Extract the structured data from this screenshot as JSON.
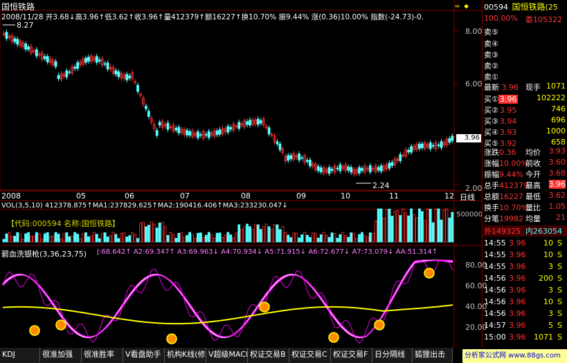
{
  "header": {
    "stock_name": "国恒铁路",
    "quote_line": "2008/11/28 开3.68↓高3.96↑低3.62↑收3.96↑量412379↑额16227↑换10.70% 振9.44% 涨(0.36)10.00% 指数(-24.73)-0.",
    "high_label": "8.27",
    "low_label": "2.24",
    "price_tag": "3.96",
    "scroll_icons": "⇔ ◆"
  },
  "price_axis": [
    "8.00",
    "6.00",
    "4.00",
    "2.00"
  ],
  "date_axis": [
    "2008",
    "05",
    "06",
    "07",
    "08",
    "09",
    "10",
    "11",
    "12"
  ],
  "period_label": "日线",
  "vol": {
    "line": "VOL(3,5,10) 412378.875↑MA1:237829.625↑MA2:190416.406↑MA3:233230.047↓",
    "code_box": "【代码:000594 名称:国恒铁路】",
    "axis": "500000"
  },
  "indicator": {
    "line_name": "碧血洗银枪(3,36,23,75)",
    "line_values": "J:68.642↑ A2:69.347↑ A3:69.963↓ A4:70.934↓ A5:71.915↓ A6:72.677↓ A7:73.079↓ AA:51.314↑",
    "axis": [
      "80.00",
      "60.00",
      "40.00",
      "20.00"
    ],
    "badge": "B"
  },
  "colors": {
    "bg": "#000000",
    "frame": "#800000",
    "up": "#ff3232",
    "down": "#54ffff",
    "ma_white": "#ffffff",
    "ma_yellow": "#ffff00",
    "ma_purple": "#ff00ff",
    "ma_green": "#00ff00",
    "label_blue": "#66a3ff"
  },
  "panel": {
    "code": "00594",
    "name": "国恒铁路",
    "suffix": "(25",
    "weibi_label": "100.00%",
    "weicha_label": "委105322",
    "asks": [
      "卖⑤",
      "卖④",
      "卖③",
      "卖②",
      "卖①"
    ],
    "latest_label": "最新",
    "latest_price": "3.96",
    "now_hand_label": "现手",
    "now_hand_value": "1071",
    "bids": [
      {
        "label": "买①",
        "price": "3.96",
        "volume": "102222"
      },
      {
        "label": "买②",
        "price": "3.95",
        "volume": "746"
      },
      {
        "label": "买③",
        "price": "3.94",
        "volume": "696"
      },
      {
        "label": "买④",
        "price": "3.93",
        "volume": "1000"
      },
      {
        "label": "买⑤",
        "price": "3.92",
        "volume": "658"
      }
    ],
    "stats": [
      {
        "l": "涨跌",
        "v": "0.36",
        "l2": "均价",
        "v2": "3.93"
      },
      {
        "l": "涨幅",
        "v": "10.00%",
        "l2": "前收",
        "v2": "3.60"
      },
      {
        "l": "振幅",
        "v": "9.44%",
        "l2": "今开",
        "v2": "3.68"
      },
      {
        "l": "总手",
        "v": "412379",
        "l2": "最高",
        "v2": "3.96"
      },
      {
        "l": "总额",
        "v": "16227",
        "l2": "最低",
        "v2": "3.62"
      },
      {
        "l": "换手",
        "v": "10.70%",
        "l2": "量比",
        "v2": "1.05"
      },
      {
        "l": "分笔",
        "v": "19982",
        "l2": "均量",
        "v2": "21"
      }
    ],
    "outer": "外149325",
    "inner": "内263054",
    "ticks": [
      {
        "time": "14:55",
        "price": "3.96",
        "vol": "10",
        "flag": "S"
      },
      {
        "time": "14:55",
        "price": "3.96",
        "vol": "10",
        "flag": "S"
      },
      {
        "time": "14:55",
        "price": "3.96",
        "vol": "3",
        "flag": "S"
      },
      {
        "time": "14:56",
        "price": "3.96",
        "vol": "200",
        "flag": "S"
      },
      {
        "time": "14:56",
        "price": "3.96",
        "vol": "3",
        "flag": "S"
      },
      {
        "time": "14:56",
        "price": "3.96",
        "vol": "10",
        "flag": "S"
      },
      {
        "time": "14:56",
        "price": "3.96",
        "vol": "3",
        "flag": "S"
      },
      {
        "time": "14:57",
        "price": "3.96",
        "vol": "5",
        "flag": "S"
      },
      {
        "time": "15:00",
        "price": "3.96",
        "vol": "1071",
        "flag": "S"
      }
    ]
  },
  "tabs": [
    "KDJ",
    "很准加强",
    "很准胜率",
    "V看盘助手",
    "机构K线(修",
    "V超级MACD",
    "权证交易B",
    "权证交易C",
    "权证交易F",
    "日分隔线",
    "狐狸出击"
  ],
  "watermark": "分析家公式网 www.88gs.com"
}
